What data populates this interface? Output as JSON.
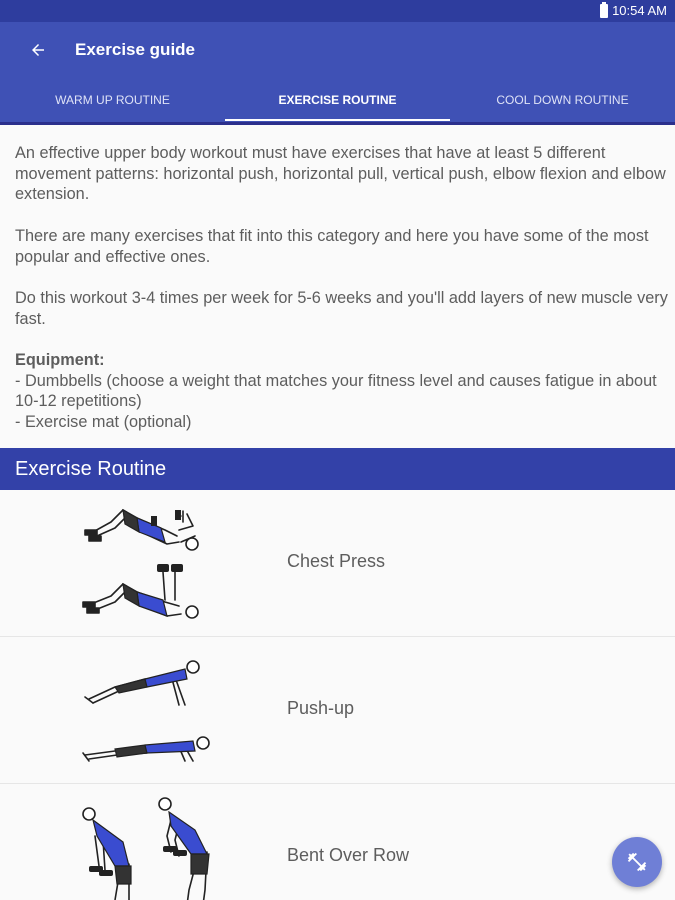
{
  "status_bar": {
    "time": "10:54 AM"
  },
  "app_bar": {
    "title": "Exercise guide"
  },
  "tabs": [
    {
      "label": "WARM UP ROUTINE",
      "active": false
    },
    {
      "label": "EXERCISE ROUTINE",
      "active": true
    },
    {
      "label": "COOL DOWN ROUTINE",
      "active": false
    }
  ],
  "intro": {
    "p1": "An effective upper body workout must have exercises that have at least 5 different movement patterns: horizontal push, horizontal pull, vertical push, elbow flexion and elbow extension.",
    "p2": "There are many exercises that fit into this category and here you have some of the most popular and effective ones.",
    "p3": "Do this workout 3-4 times per week for 5-6 weeks and you'll add layers of new muscle very fast.",
    "equipment_title": "Equipment:",
    "equipment": [
      "- Dumbbells (choose a weight that matches your fitness level and causes fatigue in about 10-12 repetitions)",
      "- Exercise mat (optional)"
    ]
  },
  "section": {
    "title": "Exercise Routine"
  },
  "exercises": [
    {
      "name": "Chest Press",
      "illustration": "chest-press-illustration"
    },
    {
      "name": "Push-up",
      "illustration": "push-up-illustration"
    },
    {
      "name": "Bent Over Row",
      "illustration": "bent-over-row-illustration"
    }
  ],
  "colors": {
    "status_bar": "#2e3d9e",
    "primary": "#3f51b5",
    "section_header": "#3341a8",
    "fab": "#6f7fd6",
    "shirt_blue": "#3a4cd0"
  },
  "icons": {
    "back": "arrow-left-icon",
    "battery": "battery-icon",
    "fab": "dumbbell-icon"
  }
}
